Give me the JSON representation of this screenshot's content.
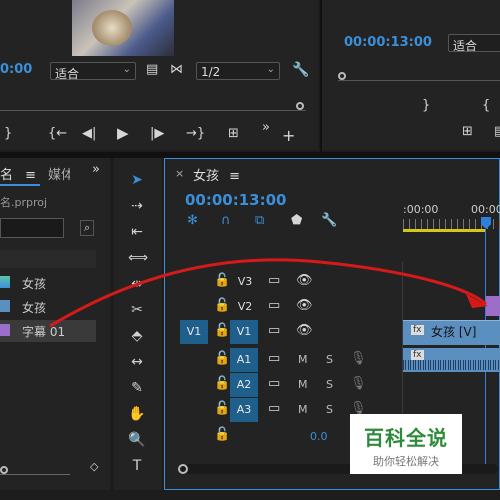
{
  "source_monitor": {
    "timecode": "0:00",
    "fit_label": "适合",
    "resolution": "1/2",
    "marker_icon": "wrench-icon"
  },
  "program_monitor": {
    "timecode": "00:00:13:00",
    "fit_label": "适合"
  },
  "project_panel": {
    "tab_name": "名",
    "tab_media": "媒体",
    "project_file": "名.prproj",
    "items": [
      {
        "label": "女孩"
      },
      {
        "label": "女孩"
      },
      {
        "label": "字幕 01"
      }
    ]
  },
  "timeline": {
    "sequence_name": "女孩",
    "timecode": "00:00:13:00",
    "ruler_labels": [
      ":00:00",
      "00:00"
    ],
    "tracks": [
      {
        "name": "V3",
        "source": ""
      },
      {
        "name": "V2",
        "source": ""
      },
      {
        "name": "V1",
        "source": "V1"
      },
      {
        "name": "A1",
        "source": "",
        "m": "M",
        "s": "S"
      },
      {
        "name": "A2",
        "source": "",
        "m": "M",
        "s": "S"
      },
      {
        "name": "A3",
        "source": "",
        "m": "M",
        "s": "S"
      }
    ],
    "master_value": "0.0",
    "clip_label": "女孩 [V]",
    "clip_fx": "fx"
  },
  "watermark": {
    "title": "百科全说",
    "subtitle": "助你轻松解决"
  },
  "colors": {
    "accent_blue": "#3b8fd8",
    "track_blue": "#1f5f8b",
    "clip_blue": "#5b8fbf",
    "playhead": "#2f7fe0",
    "arrow_red": "#d61a1a",
    "title_clip_purple": "#9b6fc9"
  }
}
